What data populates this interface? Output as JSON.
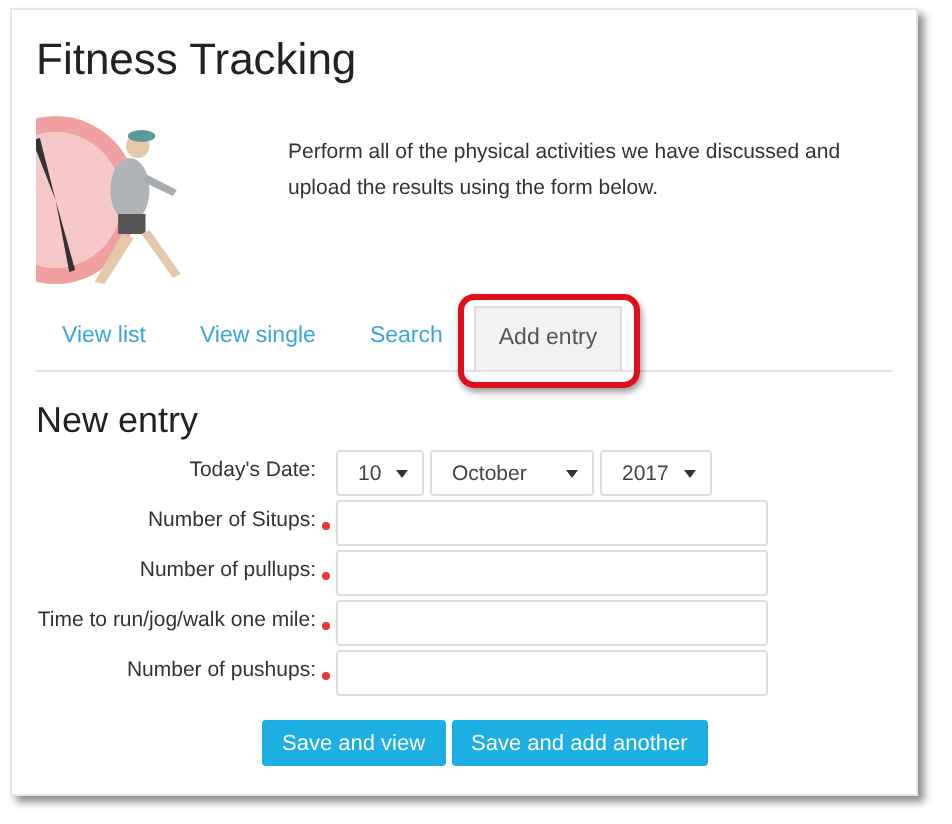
{
  "title": "Fitness Tracking",
  "intro": {
    "text": "Perform all of the physical activities we have discussed and upload the results using the form below."
  },
  "tabs": [
    {
      "label": "View list",
      "selected": false,
      "highlighted": false
    },
    {
      "label": "View single",
      "selected": false,
      "highlighted": false
    },
    {
      "label": "Search",
      "selected": false,
      "highlighted": false
    },
    {
      "label": "Add entry",
      "selected": true,
      "highlighted": true
    }
  ],
  "form": {
    "heading": "New entry",
    "date": {
      "label": "Today's Date:",
      "day": "10",
      "month": "October",
      "year": "2017"
    },
    "fields": [
      {
        "label": "Number of Situps:",
        "required": true
      },
      {
        "label": "Number of pullups:",
        "required": true
      },
      {
        "label": "Time to run/jog/walk one mile:",
        "required": true
      },
      {
        "label": "Number of pushups:",
        "required": true
      }
    ],
    "buttons": [
      "Save and view",
      "Save and add another"
    ]
  }
}
